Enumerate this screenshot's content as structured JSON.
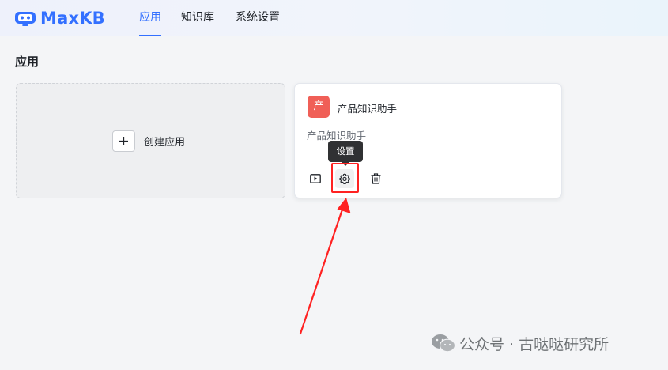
{
  "header": {
    "logo_text": "MaxKB",
    "nav": [
      {
        "label": "应用",
        "active": true
      },
      {
        "label": "知识库",
        "active": false
      },
      {
        "label": "系统设置",
        "active": false
      }
    ]
  },
  "main": {
    "title": "应用",
    "create_card": {
      "label": "创建应用"
    },
    "app_card": {
      "avatar_letter": "产",
      "name": "产品知识助手",
      "description": "产品知识助手",
      "tooltip": "设置",
      "actions": [
        "play-icon",
        "gear-icon",
        "trash-icon"
      ]
    }
  },
  "watermark": {
    "text": "公众号 · 古哒哒研究所"
  },
  "colors": {
    "accent": "#3370ff",
    "avatar_bg": "#f05f57",
    "annotation_red": "#ff2222",
    "tooltip_bg": "#303133"
  }
}
